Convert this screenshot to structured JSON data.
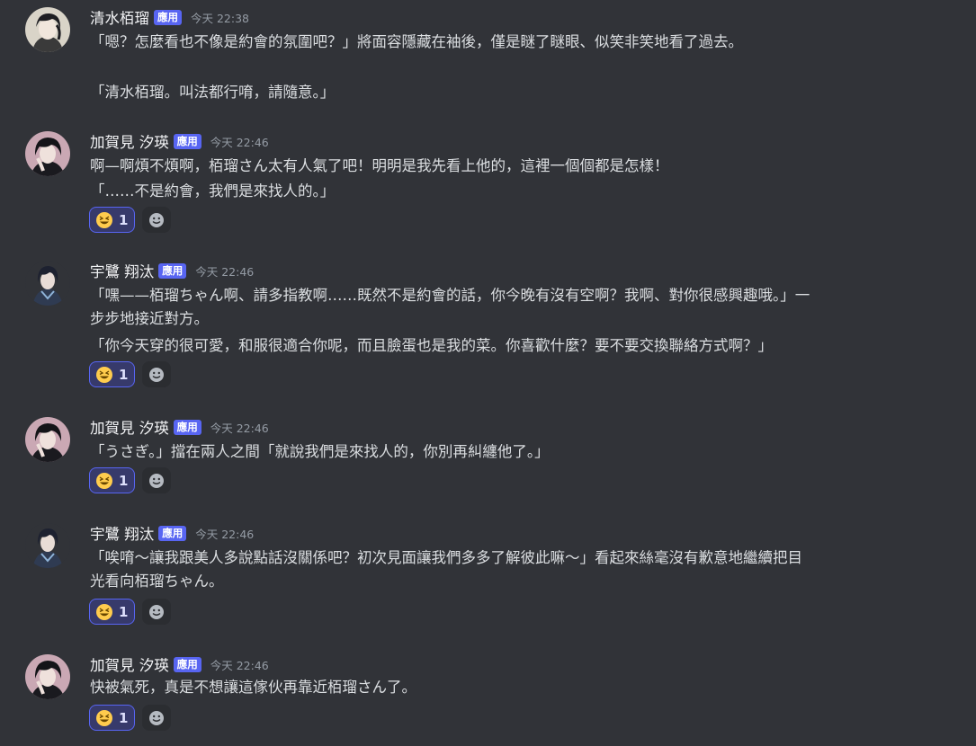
{
  "channel": {
    "messages": [
      {
        "author": "清水栢瑠",
        "badge": "應用",
        "time": "今天 22:38",
        "avatar": "avatar-kiyomizu",
        "lines": [
          "「嗯？怎麼看也不像是約會的氛圍吧？」將面容隱藏在袖後，僅是瞇了瞇眼、似笑非笑地看了過去。",
          "「清水栢瑠。叫法都行唷，請隨意。」"
        ]
      },
      {
        "author": "加賀見 汐瑛",
        "badge": "應用",
        "time": "今天 22:46",
        "avatar": "avatar-kagami",
        "lines": [
          "啊—啊煩不煩啊，栢瑠さん太有人氣了吧！明明是我先看上他的，這裡一個個都是怎樣！",
          "「……不是約會，我們是來找人的。」"
        ],
        "reaction": {
          "emoji": "grinning-squinting-face",
          "count": "1"
        }
      },
      {
        "author": "宇鷺 翔汰",
        "badge": "應用",
        "time": "今天 22:46",
        "avatar": "avatar-usagi",
        "lines": [
          "「嘿——栢瑠ちゃん啊、請多指教啊……既然不是約會的話，你今晚有沒有空啊？我啊、對你很感興趣哦。」一",
          "步步地接近對方。",
          "「你今天穿的很可愛，和服很適合你呢，而且臉蛋也是我的菜。你喜歡什麼？要不要交換聯絡方式啊？」"
        ],
        "reaction": {
          "emoji": "grinning-squinting-face",
          "count": "1"
        }
      },
      {
        "author": "加賀見 汐瑛",
        "badge": "應用",
        "time": "今天 22:46",
        "avatar": "avatar-kagami",
        "lines": [
          "「うさぎ。」擋在兩人之間「就說我們是來找人的，你別再糾纏他了。」"
        ],
        "reaction": {
          "emoji": "grinning-squinting-face",
          "count": "1"
        }
      },
      {
        "author": "宇鷺 翔汰",
        "badge": "應用",
        "time": "今天 22:46",
        "avatar": "avatar-usagi",
        "lines": [
          "「唉唷～讓我跟美人多說點話沒關係吧？初次見面讓我們多多了解彼此嘛～」看起來絲毫沒有歉意地繼續把目",
          "光看向栢瑠ちゃん。"
        ],
        "reaction": {
          "emoji": "grinning-squinting-face",
          "count": "1"
        }
      },
      {
        "author": "加賀見 汐瑛",
        "badge": "應用",
        "time": "今天 22:46",
        "avatar": "avatar-kagami",
        "lines": [
          "快被氣死，真是不想讓這傢伙再靠近栢瑠さん了。"
        ],
        "reaction": {
          "emoji": "grinning-squinting-face",
          "count": "1"
        }
      }
    ]
  },
  "colors": {
    "background": "#313338",
    "badge": "#5865f2",
    "reaction_bg": "#373a6b",
    "reaction_border": "#5865f2"
  },
  "icons": {
    "add_reaction": "smiley-add-reaction-icon"
  }
}
